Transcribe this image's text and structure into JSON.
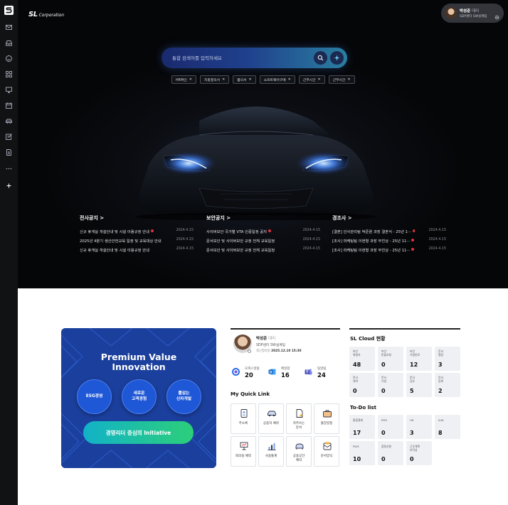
{
  "brand": {
    "logo_text": "SL",
    "name": "Corporation"
  },
  "colors": {
    "accent": "#1f58d6",
    "badge_red": "#e0313a",
    "pill_from": "#12b2c8",
    "pill_to": "#2ccf79"
  },
  "sidebar": {
    "items": [
      {
        "icon": "mail-icon"
      },
      {
        "icon": "inbox-icon"
      },
      {
        "icon": "smile-icon"
      },
      {
        "icon": "apps-icon"
      },
      {
        "icon": "monitor-icon"
      },
      {
        "icon": "calendar-icon"
      },
      {
        "icon": "car-icon"
      },
      {
        "icon": "edit-icon"
      },
      {
        "icon": "document-icon"
      },
      {
        "icon": "more-icon"
      },
      {
        "icon": "add-icon"
      }
    ]
  },
  "profile": {
    "name": "박성준",
    "rank": "대리",
    "dept": "SDP센터 SW설계팀"
  },
  "search": {
    "placeholder": "통합 검색어를 입력하세요"
  },
  "chips": [
    "HR확인",
    "지출결의서",
    "품의서",
    "소프트웨어구매",
    "근무시간",
    "근무시간"
  ],
  "notices": [
    {
      "title": "전사공지 >",
      "items": [
        {
          "text": "신규 휴게실 개설안내 및 시설 이용규정 안내",
          "date": "2024.4.15",
          "new": true
        },
        {
          "text": "2025년 4분기 생산안전교육 일정 및 교육대상 안내",
          "date": "2024.4.15",
          "new": false
        },
        {
          "text": "신규 휴게실 개설안내 및 시설 이용규정 안내",
          "date": "2024.4.15",
          "new": false
        }
      ]
    },
    {
      "title": "보안공지 >",
      "items": [
        {
          "text": "사이버보안 국가별 VTA 인증일정 공지",
          "date": "2024.4.15",
          "new": true
        },
        {
          "text": "문서보안 및 사이버보안 규정 전체 교육일정",
          "date": "2024.4.15",
          "new": false
        },
        {
          "text": "문서보안 및 사이버보안 규정 전체 교육일정",
          "date": "2024.4.15",
          "new": false
        }
      ]
    },
    {
      "title": "경조사 >",
      "items": [
        {
          "text": "[결혼] 인사관리팀 박준원 과장 결혼식 - 25년 1···",
          "date": "2024.4.15",
          "new": true
        },
        {
          "text": "[조사] 마케팅팀 이현형 과장 부친상 - 25년 11···",
          "date": "2024.4.15",
          "new": true
        },
        {
          "text": "[조사] 마케팅팀 이현형 과장 부친상 - 25년 11···",
          "date": "2024.4.15",
          "new": true
        }
      ]
    }
  ],
  "banner": {
    "title_line1": "Premium Value",
    "title_line2": "Innovation",
    "circles": [
      "ESG경영",
      "새로운\n고객경험",
      "틀없는\n신차개발"
    ],
    "cta": "경영리더 중심의 Initiative"
  },
  "user_card": {
    "name": "박성준",
    "rank": "대리",
    "dept": "SDP센터 SW설계팀",
    "last_login_label": "최근접속일",
    "last_login": "2025.12.10  15:30"
  },
  "counts": [
    {
      "label": "오피스알림",
      "value": "20",
      "icon": "office-icon"
    },
    {
      "label": "메일함",
      "value": "16",
      "icon": "outlook-icon"
    },
    {
      "label": "팀알림",
      "value": "24",
      "icon": "teams-icon"
    }
  ],
  "quick_link": {
    "title": "My Quick Link",
    "items": [
      {
        "label": "주소록",
        "icon": "address-book-icon"
      },
      {
        "label": "공용차 예약",
        "icon": "car-icon"
      },
      {
        "label": "자주쓰는\n문서",
        "icon": "favorite-doc-icon"
      },
      {
        "label": "출장일정",
        "icon": "briefcase-icon"
      },
      {
        "label": "회의실 예약",
        "icon": "meeting-room-icon"
      },
      {
        "label": "사용통계",
        "icon": "stats-icon"
      },
      {
        "label": "공용공간\n예약",
        "icon": "shared-space-icon"
      },
      {
        "label": "문서양식",
        "icon": "form-icon"
      }
    ]
  },
  "cloud": {
    "title": "SL Cloud 현황",
    "items": [
      {
        "label": "보안\n위험자",
        "value": "48"
      },
      {
        "label": "보안\n반출요청",
        "value": "0"
      },
      {
        "label": "보안\n기밀만료",
        "value": "12"
      },
      {
        "label": "문서\n열람",
        "value": "3"
      },
      {
        "label": "문서\n대여",
        "value": "0"
      },
      {
        "label": "문서\n기밀",
        "value": "0"
      },
      {
        "label": "문서\n공유",
        "value": "5"
      },
      {
        "label": "문서\n등록",
        "value": "2"
      }
    ]
  },
  "todo": {
    "title": "To-Do list",
    "items": [
      {
        "label": "통합결재",
        "value": "17"
      },
      {
        "label": "PMS",
        "value": "0"
      },
      {
        "label": "HR",
        "value": "3"
      },
      {
        "label": "S/W",
        "value": "8"
      },
      {
        "label": "PDM",
        "value": "10"
      },
      {
        "label": "품질사항",
        "value": "0"
      },
      {
        "label": "근무계획\n미작성",
        "value": "0"
      }
    ]
  }
}
